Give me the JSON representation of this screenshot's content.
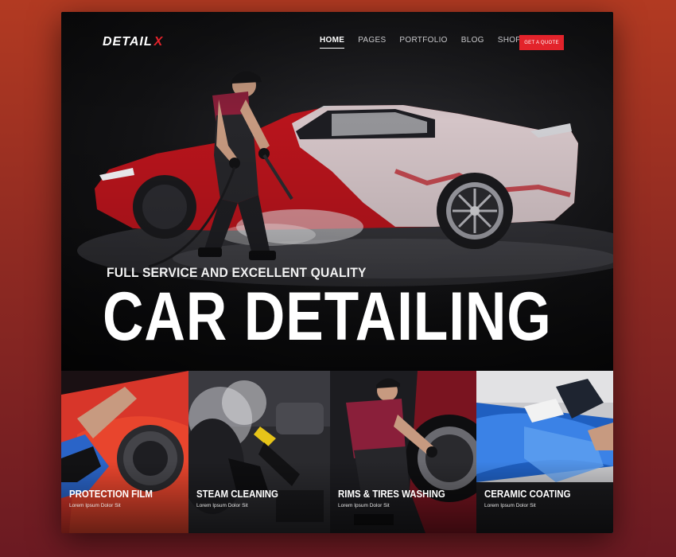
{
  "brand": {
    "logo_main": "DETAIL",
    "logo_accent": "X"
  },
  "nav": {
    "items": [
      {
        "label": "HOME",
        "active": true
      },
      {
        "label": "PAGES",
        "active": false
      },
      {
        "label": "PORTFOLIO",
        "active": false
      },
      {
        "label": "BLOG",
        "active": false
      },
      {
        "label": "SHOP",
        "active": false
      }
    ],
    "cta_label": "GET A QUOTE"
  },
  "hero": {
    "eyebrow": "FULL SERVICE AND EXCELLENT QUALITY",
    "headline": "CAR DETAILING"
  },
  "services": [
    {
      "title": "PROTECTION FILM",
      "subtitle": "Lorem Ipsum Dolor Sit"
    },
    {
      "title": "STEAM CLEANING",
      "subtitle": "Lorem Ipsum Dolor Sit"
    },
    {
      "title": "RIMS & TIRES WASHING",
      "subtitle": "Lorem Ipsum Dolor Sit"
    },
    {
      "title": "CERAMIC COATING",
      "subtitle": "Lorem Ipsum Dolor Sit"
    }
  ],
  "colors": {
    "accent": "#e3232b",
    "background": "#0c0c0e",
    "page_bg_top": "#b23a22",
    "page_bg_bottom": "#6b1a22"
  }
}
